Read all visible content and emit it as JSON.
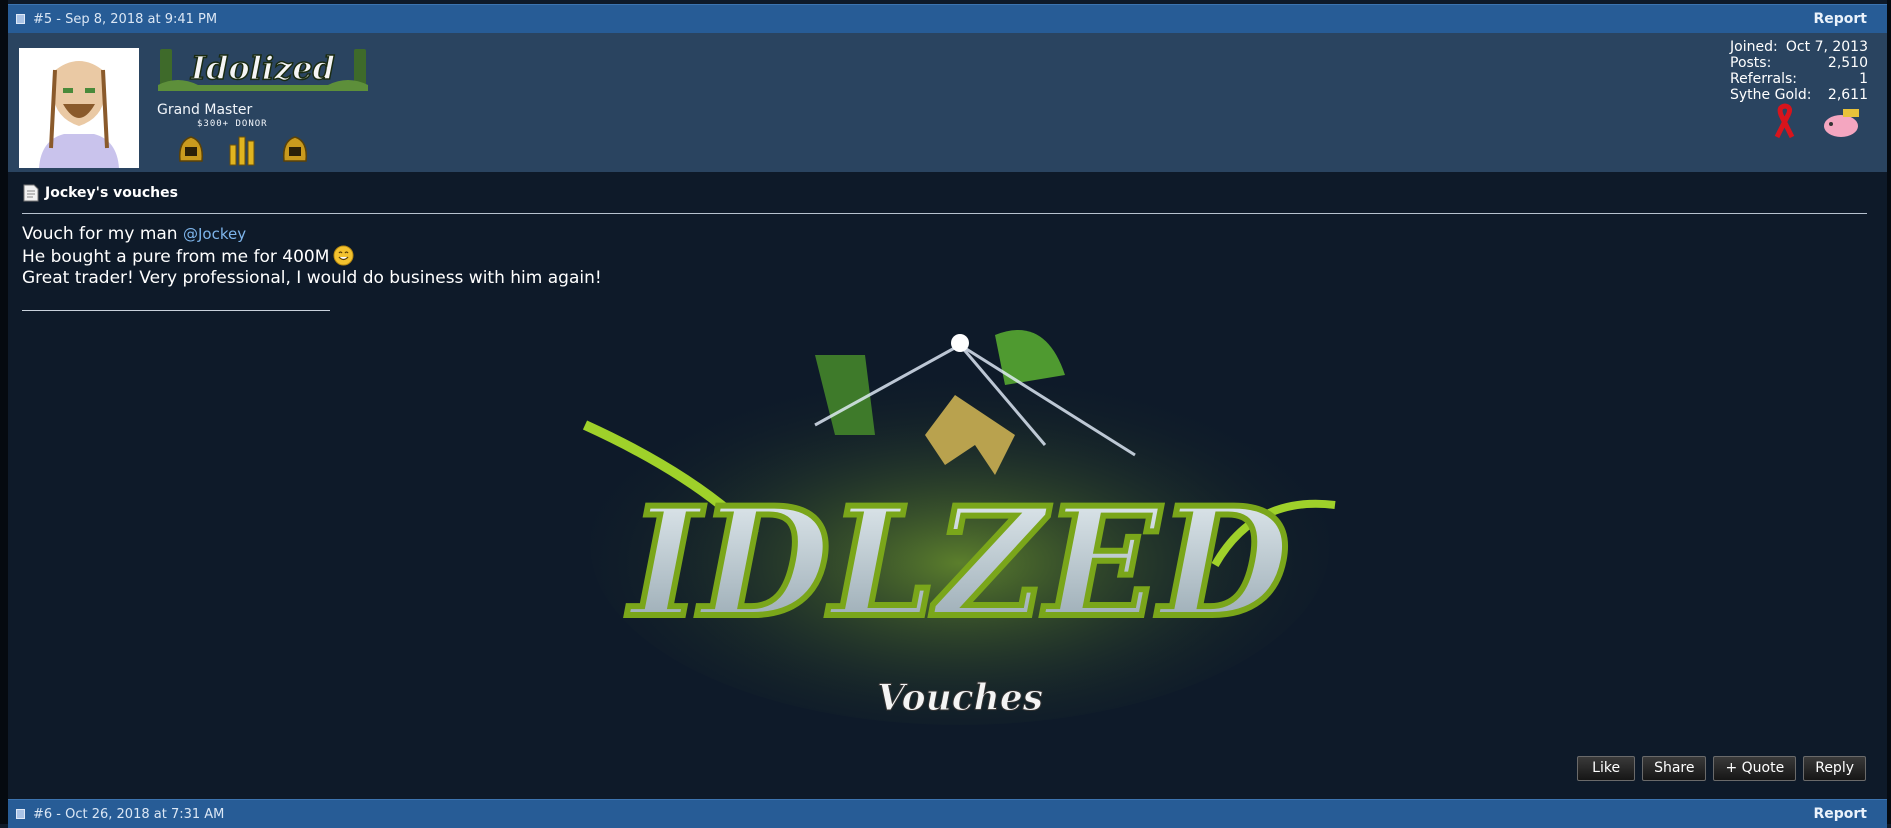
{
  "post1": {
    "header": "#5 - Sep 8, 2018 at 9:41 PM",
    "report_label": "Report"
  },
  "user": {
    "usertitle_logo_text": "Idolized",
    "rank": "Grand Master",
    "donor_label": "$300+ DONOR",
    "stats": [
      {
        "label": "Joined:",
        "value": "Oct 7, 2013"
      },
      {
        "label": "Posts:",
        "value": "2,510"
      },
      {
        "label": "Referrals:",
        "value": "1"
      },
      {
        "label": "Sythe Gold:",
        "value": "2,611"
      }
    ]
  },
  "post": {
    "title": "Jockey's vouches",
    "line1_text": "Vouch for my man ",
    "mention": "@Jockey",
    "line2_text": "He bought a pure from me for 400M",
    "line3_text": "Great trader! Very professional, I would do business with him again!",
    "signature_logo_text": "IDLZED",
    "signature_subtitle": "Vouches"
  },
  "actions": {
    "like": "Like",
    "share": "Share",
    "quote": "+ Quote",
    "reply": "Reply"
  },
  "post2": {
    "header": "#6 - Oct 26, 2018 at 7:31 AM",
    "report_label": "Report"
  },
  "colors": {
    "header_bar": "#275c96",
    "userbar": "#2a4460",
    "background": "#0e1a29",
    "mention": "#7db4ea"
  }
}
